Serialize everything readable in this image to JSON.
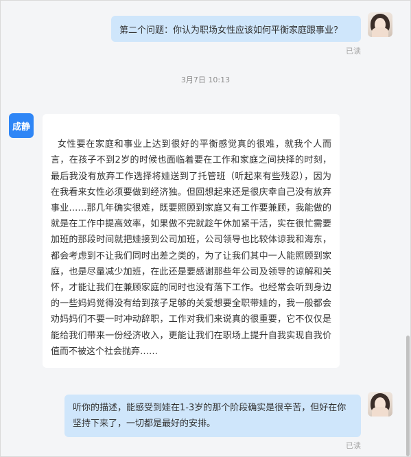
{
  "messages": [
    {
      "sender": "self",
      "text": "第二个问题：你认为职场女性应该如何平衡家庭跟事业？",
      "status": "已读"
    },
    {
      "sender": "other",
      "avatar_label": "成静",
      "text": "女性要在家庭和事业上达到很好的平衡感觉真的很难，就我个人而言，在孩子不到2岁的时候也面临着要在工作和家庭之间抉择的时刻，最后我没有放弃工作选择将娃送到了托管班（听起来有些残忍），因为在我看来女性必须要做到经济独。但回想起来还是很庆幸自己没有放弃事业……那几年确实很难，既要照顾到家庭又有工作要兼顾，我能做的就是在工作中提高效率，如果做不完就趁午休加紧干活，实在很忙需要加班的那段时间就把娃接到公司加班，公司领导也比较体谅我和海东，都会考虑到不让我们同时出差之类的，为了让我们其中一人能照顾到家庭，也是尽量减少加班，在此还是要感谢那些年公司及领导的谅解和关怀，才能让我们在兼顾家庭的同时也没有落下工作。也经常会听到身边的一些妈妈觉得没有给到孩子足够的关爱想要全职带娃的，我一般都会劝妈妈们不要一时冲动辞职，工作对我们来说真的很重要，它不仅仅是能给我们带来一份经济收入，更能让我们在职场上提升自我实现自我价值而不被这个社会抛弃……"
    },
    {
      "sender": "self",
      "text": "听你的描述，能感受到娃在1-3岁的那个阶段确实是很辛苦，但好在你坚持下来了，一切都是最好的安排。",
      "status": "已读"
    }
  ],
  "timestamp": "3月7日 10:13",
  "colors": {
    "self_bubble": "#cfe6fb",
    "other_bubble": "#ffffff",
    "other_avatar": "#2f86f6",
    "background": "#f4f5f7"
  },
  "icons": {
    "self_avatar": "user-photo-avatar"
  }
}
